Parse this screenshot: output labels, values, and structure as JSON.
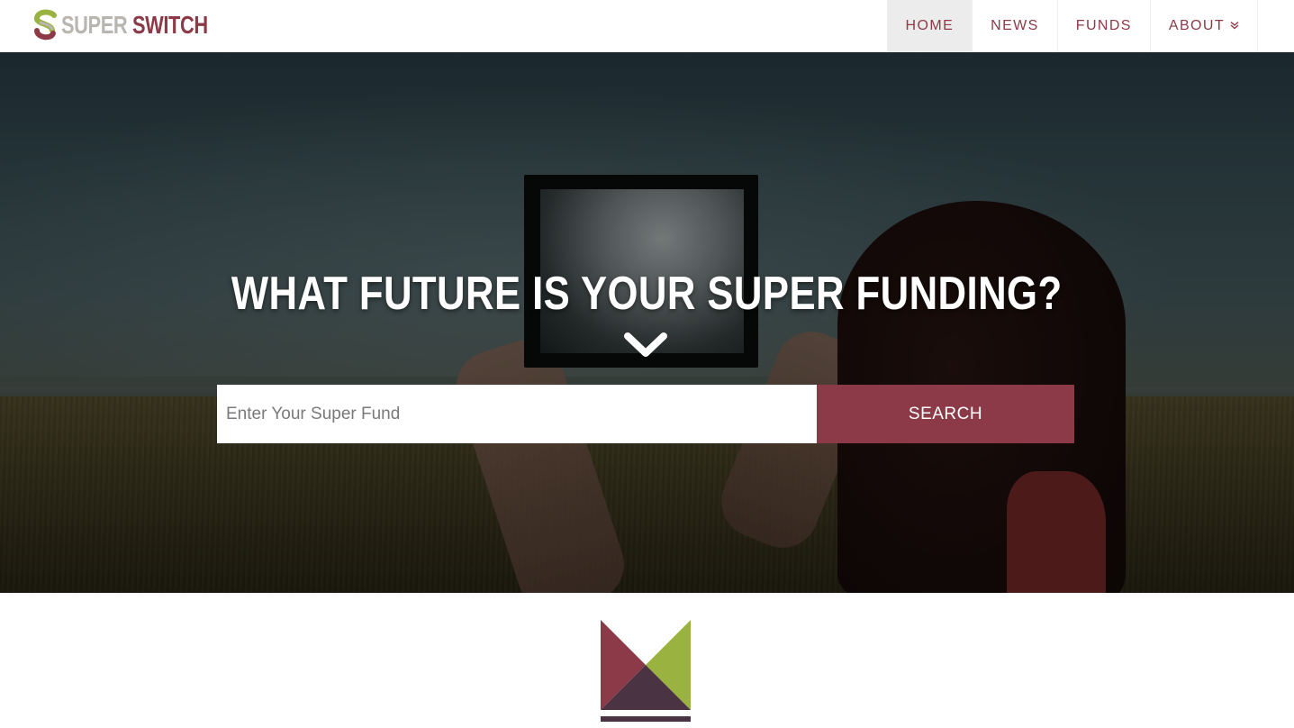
{
  "brand": {
    "word1": "SUPER",
    "word2": "SWITCH",
    "colors": {
      "primary": "#8c3a47",
      "grey": "#b9b5b0",
      "green": "#9ab23f",
      "dark": "#4a3443"
    }
  },
  "nav": {
    "items": [
      {
        "label": "HOME",
        "active": true
      },
      {
        "label": "NEWS",
        "active": false
      },
      {
        "label": "FUNDS",
        "active": false
      },
      {
        "label": "ABOUT",
        "active": false,
        "icon": "double-chevron-down-icon"
      }
    ]
  },
  "hero": {
    "title": "WHAT FUTURE IS YOUR SUPER FUNDING?",
    "scroll_icon": "chevron-down-icon",
    "search": {
      "placeholder": "Enter Your Super Fund",
      "value": "",
      "button_label": "SEARCH"
    }
  },
  "emblem_icon": "super-switch-emblem-icon"
}
